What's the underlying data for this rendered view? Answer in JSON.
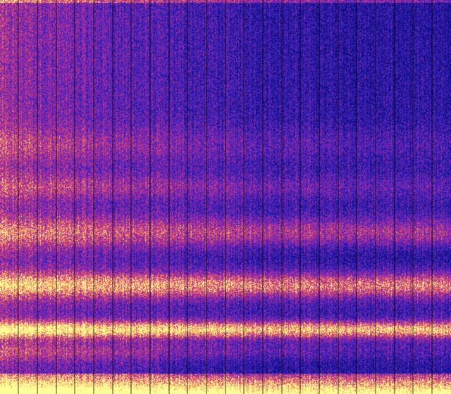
{
  "palette": {
    "low": "#0a0a6e",
    "mid_low": "#2a20c8",
    "mid": "#8a2aa8",
    "mid_high": "#d8308a",
    "high": "#f08040",
    "peak": "#ffff9a"
  },
  "divider_color": "#000000"
}
